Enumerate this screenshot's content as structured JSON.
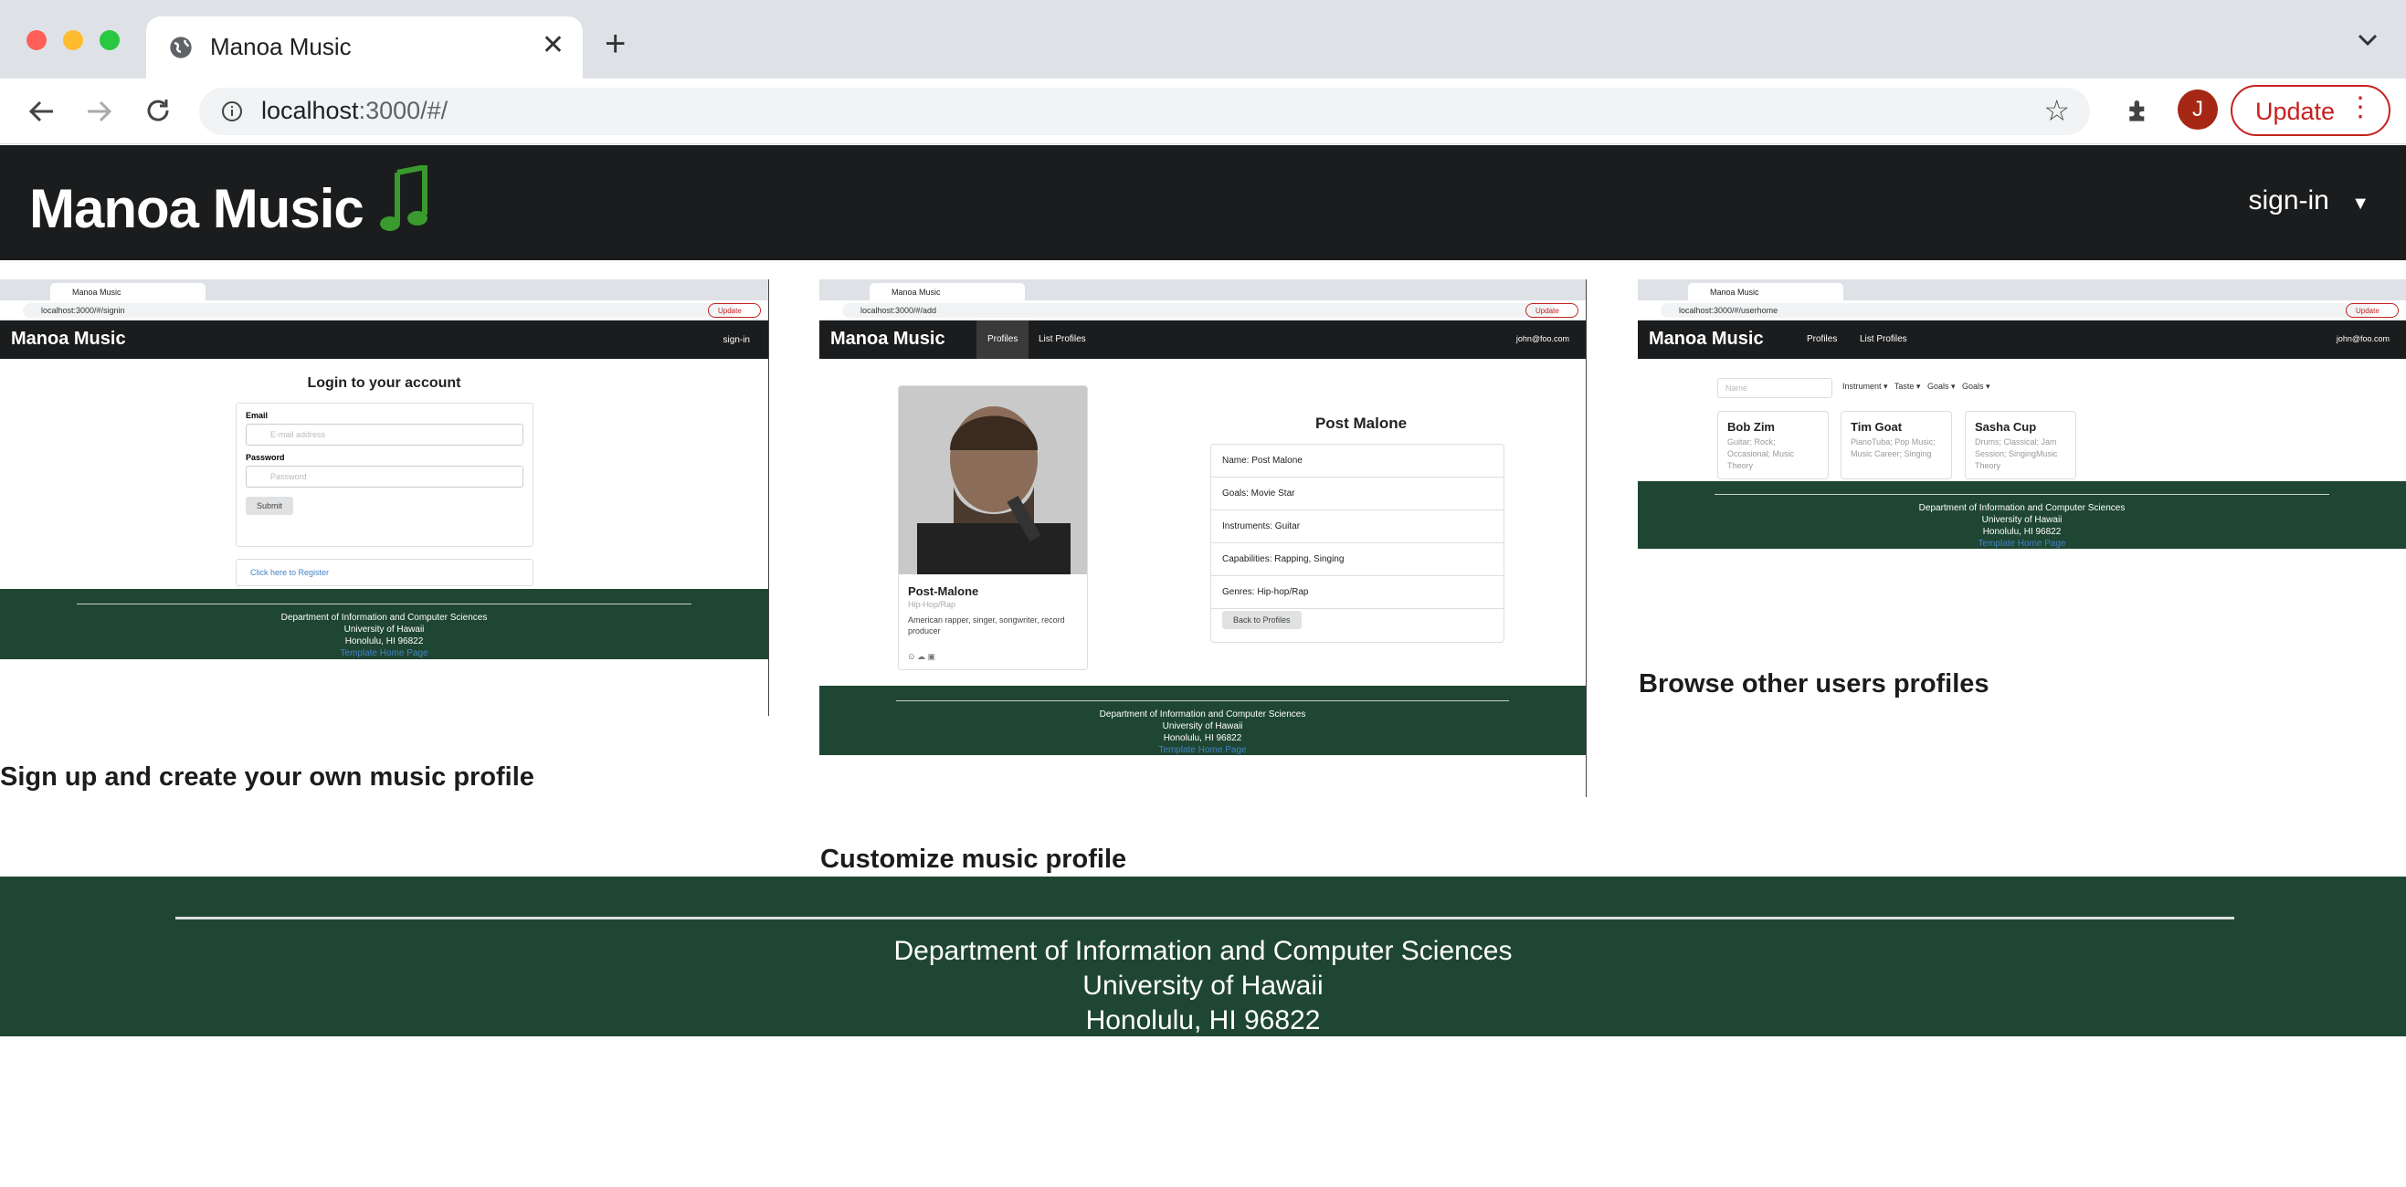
{
  "browser": {
    "tab_title": "Manoa Music",
    "url_host": "localhost",
    "url_path": ":3000/#/",
    "avatar_letter": "J",
    "update_label": "Update"
  },
  "navbar": {
    "brand": "Manoa Music",
    "signin_label": "sign-in"
  },
  "shot_signin": {
    "tab": "Manoa Music",
    "url": "localhost:3000/#/signin",
    "update": "Update",
    "brand": "Manoa Music",
    "signin": "sign-in",
    "heading": "Login to your account",
    "email_label": "Email",
    "email_placeholder": "E-mail address",
    "password_label": "Password",
    "password_placeholder": "Password",
    "submit": "Submit",
    "register_link": "Click here to Register",
    "caption": "Sign up and create your own music profile"
  },
  "shot_profile": {
    "tab": "Manoa Music",
    "url": "localhost:3000/#/add",
    "update": "Update",
    "brand": "Manoa Music",
    "nav_profiles": "Profiles",
    "nav_list": "List Profiles",
    "user": "john@foo.com",
    "card_name": "Post-Malone",
    "card_genre": "Hip-Hop/Rap",
    "card_desc": "American rapper, singer, songwriter, record producer",
    "title": "Post Malone",
    "rows": [
      "Name: Post Malone",
      "Goals: Movie Star",
      "Instruments: Guitar",
      "Capabilities: Rapping, Singing",
      "Genres: Hip-hop/Rap"
    ],
    "back_button": "Back to Profiles",
    "caption": "Customize music profile"
  },
  "shot_browse": {
    "tab": "Manoa Music",
    "url": "localhost:3000/#/userhome",
    "update": "Update",
    "brand": "Manoa Music",
    "nav_profiles": "Profiles",
    "nav_list": "List Profiles",
    "user": "john@foo.com",
    "search_placeholder": "Name",
    "filters": [
      "Instrument",
      "Taste",
      "Goals",
      "Goals"
    ],
    "cards": [
      {
        "name": "Bob Zim",
        "desc": "Guitar; Rock; Occasional; Music Theory"
      },
      {
        "name": "Tim Goat",
        "desc": "PianoTuba; Pop Music; Music Career; Singing"
      },
      {
        "name": "Sasha Cup",
        "desc": "Drums; Classical; Jam Session; SingingMusic Theory"
      }
    ],
    "caption": "Browse other users profiles"
  },
  "mini_footer": {
    "line1": "Department of Information and Computer Sciences",
    "line2": "University of Hawaii",
    "line3": "Honolulu, HI 96822",
    "link": "Template Home Page"
  },
  "footer": {
    "line1": "Department of Information and Computer Sciences",
    "line2": "University of Hawaii",
    "line3": "Honolulu, HI 96822"
  },
  "colors": {
    "navbar": "#1b1c1d",
    "footer": "#1f4633",
    "accent_green": "#3a9a2e",
    "update_red": "#c5221f"
  }
}
